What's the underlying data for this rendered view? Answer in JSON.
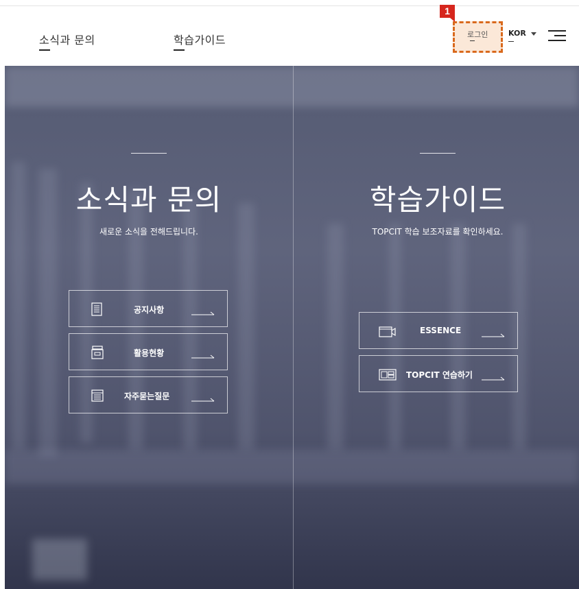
{
  "header": {
    "nav": [
      {
        "label": "소식과 문의"
      },
      {
        "label": "학습가이드"
      }
    ],
    "login_label": "로그인",
    "marker_label": "1",
    "language": "KOR",
    "menu_icon": "hamburger-icon"
  },
  "panels": {
    "left": {
      "title": "소식과 문의",
      "subtitle": "새로운 소식을 전해드립니다.",
      "links": [
        {
          "label": "공지사항",
          "icon": "document-icon"
        },
        {
          "label": "활용현황",
          "icon": "archive-box-icon"
        },
        {
          "label": "자주묻는질문",
          "icon": "browser-window-icon"
        }
      ]
    },
    "right": {
      "title": "학습가이드",
      "subtitle": "TOPCIT 학습 보조자료를 확인하세요.",
      "links": [
        {
          "label": "ESSENCE",
          "icon": "video-camera-icon"
        },
        {
          "label": "TOPCIT 연습하기",
          "icon": "layout-panels-icon"
        }
      ]
    }
  },
  "colors": {
    "highlight_border": "#d9691c",
    "highlight_fill": "#fbe8d8",
    "marker": "#d6261d",
    "hero_overlay": "#3c4260"
  }
}
